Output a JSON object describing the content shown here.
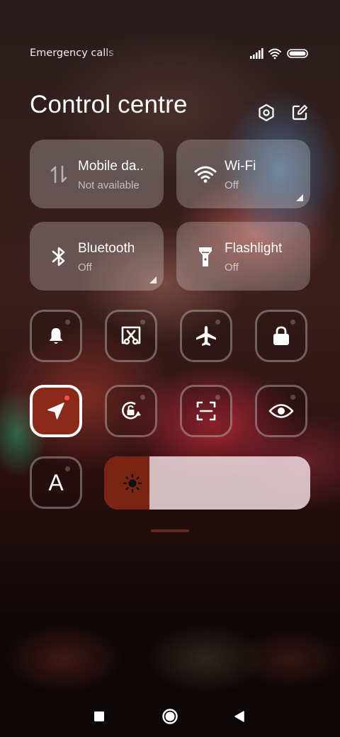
{
  "status_bar": {
    "carrier_text": "Emergency calls o",
    "icons": [
      "signal-icon",
      "wifi-icon",
      "battery-icon"
    ]
  },
  "header": {
    "title": "Control centre",
    "icons": [
      "settings-icon",
      "edit-icon"
    ]
  },
  "tiles": [
    {
      "name": "Mobile da..",
      "state": "Not available",
      "icon": "mobile-data-icon"
    },
    {
      "name": "Wi-Fi",
      "state": "Off",
      "icon": "wifi-icon"
    },
    {
      "name": "Bluetooth",
      "state": "Off",
      "icon": "bluetooth-icon"
    },
    {
      "name": "Flashlight",
      "state": "Off",
      "icon": "flashlight-icon"
    }
  ],
  "toggles": [
    {
      "icon": "bell-icon",
      "active": false
    },
    {
      "icon": "screenshot-icon",
      "active": false
    },
    {
      "icon": "airplane-icon",
      "active": false
    },
    {
      "icon": "lock-icon",
      "active": false
    },
    {
      "icon": "location-icon",
      "active": true
    },
    {
      "icon": "rotation-lock-icon",
      "active": false
    },
    {
      "icon": "scanner-icon",
      "active": false
    },
    {
      "icon": "eye-icon",
      "active": false
    }
  ],
  "auto_brightness": {
    "label": "A",
    "active": false
  },
  "brightness": {
    "level": 0.22,
    "icon": "sun-icon"
  },
  "navigation": [
    "recents-icon",
    "home-icon",
    "back-icon"
  ],
  "colors": {
    "accent_active": "#8b2a1a",
    "active_dot": "#ff4a4a"
  }
}
